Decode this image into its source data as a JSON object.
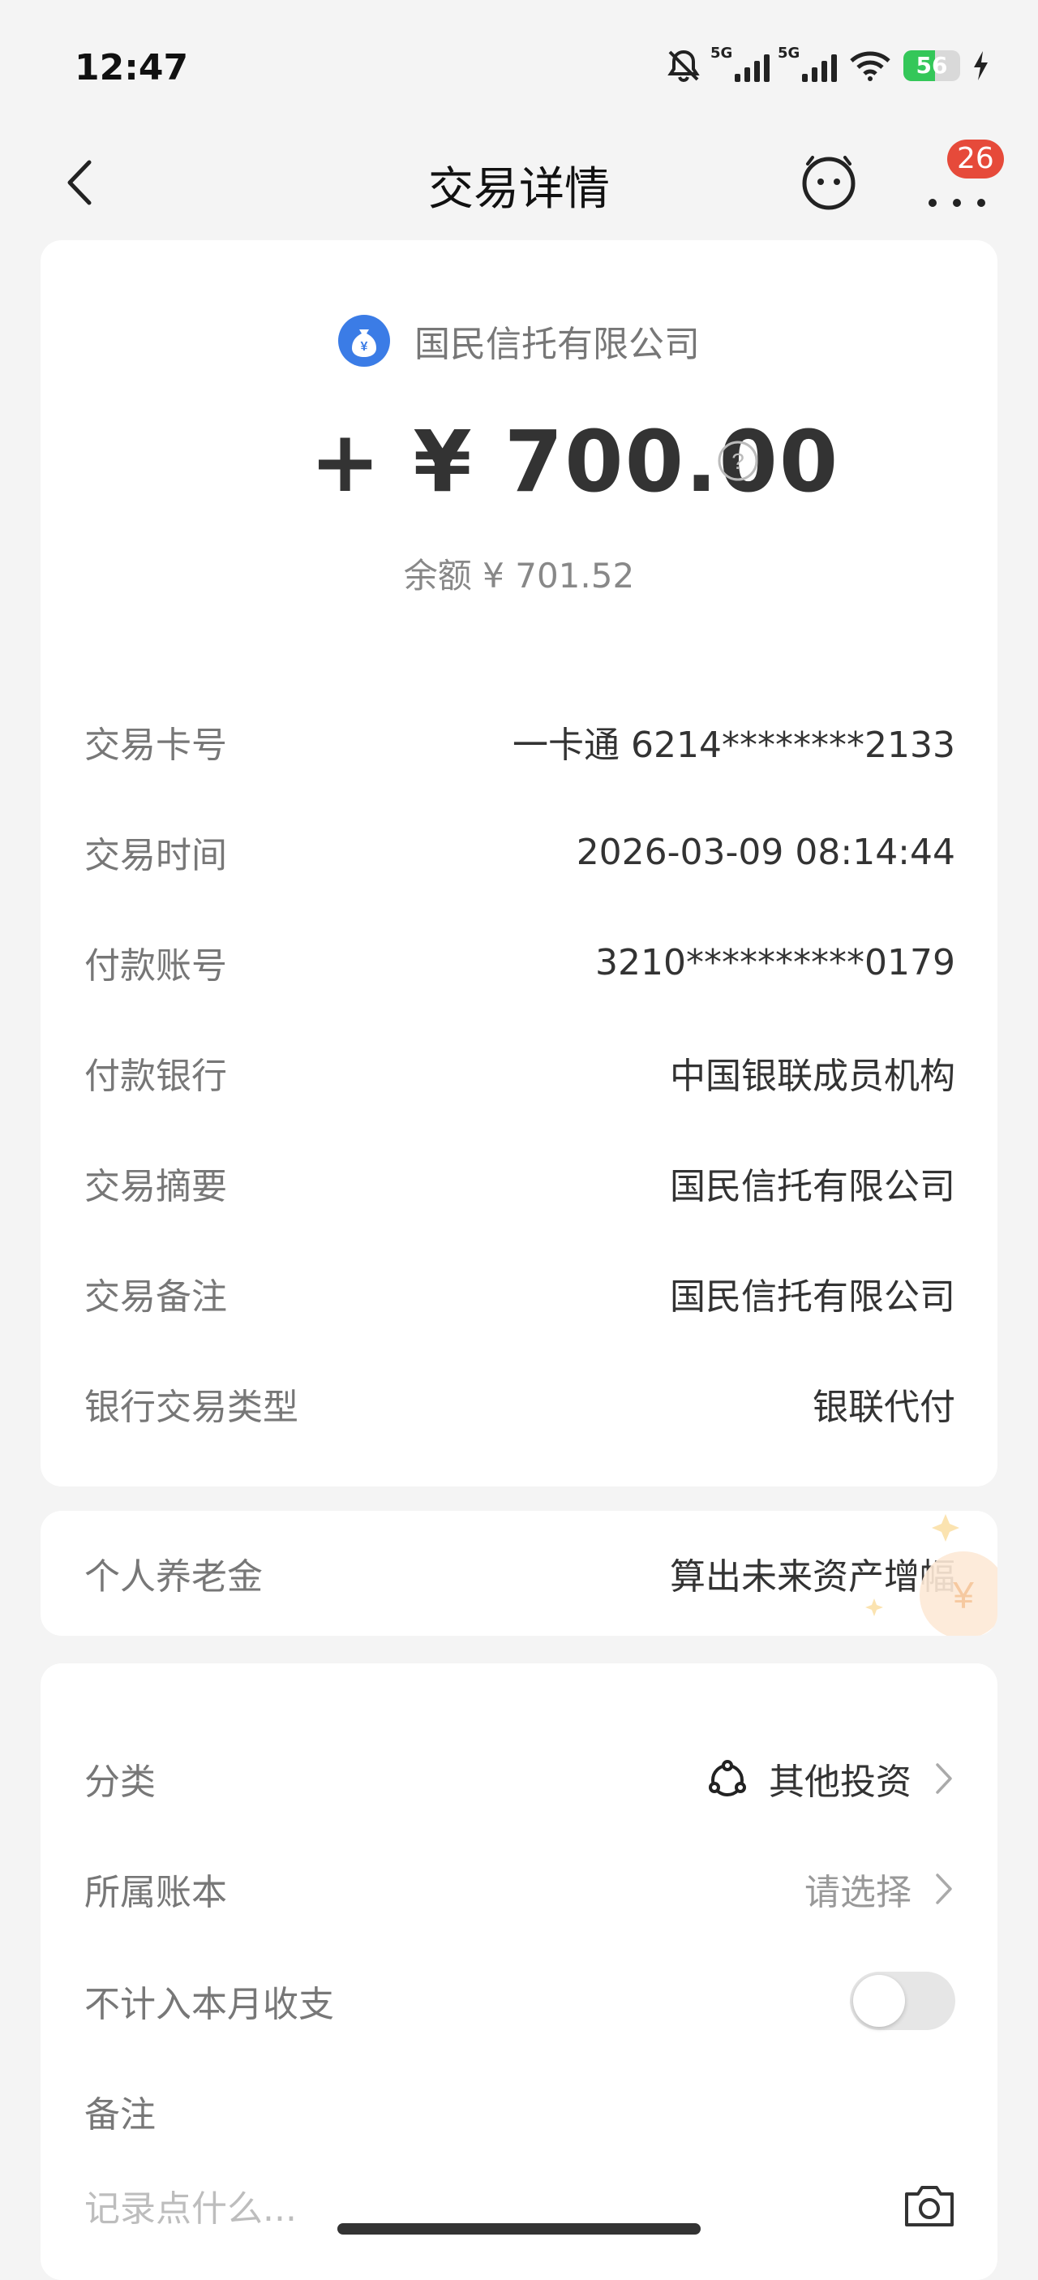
{
  "status_bar": {
    "time": "12:47",
    "network_1": "5G",
    "network_2": "5G",
    "battery": "56",
    "battery_level": 0.56,
    "icons": [
      "mute-bell-icon",
      "signal-icon",
      "wifi-icon",
      "battery-icon",
      "charging-icon"
    ]
  },
  "nav": {
    "title": "交易详情",
    "badge_count": "26",
    "icons": [
      "back-chevron-icon",
      "assistant-face-icon",
      "more-dots-icon"
    ]
  },
  "summary": {
    "merchant": "国民信托有限公司",
    "amount": "+ ¥ 700.00",
    "balance": "余额 ¥ 701.52",
    "logo_icon": "money-bag-icon",
    "accent_color": "#3b7ce6"
  },
  "details": [
    {
      "label": "交易卡号",
      "value": "一卡通 6214********2133"
    },
    {
      "label": "交易时间",
      "value": "2026-03-09 08:14:44"
    },
    {
      "label": "付款账号",
      "value": "3210**********0179"
    },
    {
      "label": "付款银行",
      "value": "中国银联成员机构"
    },
    {
      "label": "交易摘要",
      "value": "国民信托有限公司"
    },
    {
      "label": "交易备注",
      "value": "国民信托有限公司"
    },
    {
      "label": "银行交易类型",
      "value": "银联代付"
    }
  ],
  "pension": {
    "label": "个人养老金",
    "action": "算出未来资产增幅"
  },
  "settings": {
    "category_label": "分类",
    "category_value": "其他投资",
    "account_book_label": "所属账本",
    "account_book_value": "请选择",
    "exclude_label": "不计入本月收支",
    "exclude_on": false,
    "note_label": "备注",
    "note_placeholder": "记录点什么..."
  }
}
